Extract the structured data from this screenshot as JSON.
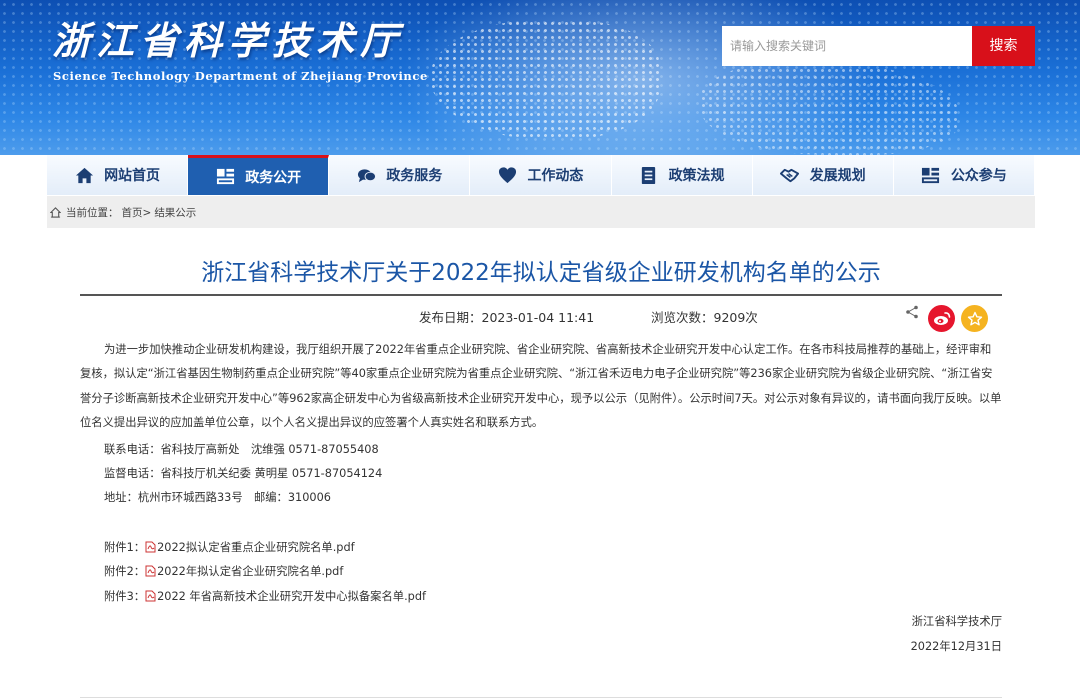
{
  "header": {
    "site_title": "浙江省科学技术厅",
    "site_subtitle": "Science Technology Department of Zhejiang Province",
    "search_placeholder": "请输入搜索关键词",
    "search_button": "搜索",
    "banner_colors": {
      "top": "#0d4fb3",
      "bottom": "#4d9cec"
    }
  },
  "nav": {
    "items": [
      {
        "label": "网站首页",
        "icon": "home-icon"
      },
      {
        "label": "政务公开",
        "icon": "gov-info-icon",
        "active": true
      },
      {
        "label": "政务服务",
        "icon": "chat-service-icon"
      },
      {
        "label": "工作动态",
        "icon": "heart-icon"
      },
      {
        "label": "政策法规",
        "icon": "document-list-icon"
      },
      {
        "label": "发展规划",
        "icon": "handshake-icon"
      },
      {
        "label": "公众参与",
        "icon": "participation-icon"
      }
    ],
    "active_color": "#1f5fb0",
    "accent_color": "#d8101a"
  },
  "breadcrumb": {
    "prefix": "当前位置：",
    "home": "首页>",
    "current": "结果公示"
  },
  "article": {
    "title": "浙江省科学技术厅关于2022年拟认定省级企业研发机构名单的公示",
    "publish_date": "发布日期：2023-01-04 11:41",
    "views": "浏览次数：9209次",
    "paragraph": "为进一步加快推动企业研发机构建设，我厅组织开展了2022年省重点企业研究院、省企业研究院、省高新技术企业研究开发中心认定工作。在各市科技局推荐的基础上，经评审和复核，拟认定“浙江省基因生物制药重点企业研究院”等40家重点企业研究院为省重点企业研究院、“浙江省禾迈电力电子企业研究院”等236家企业研究院为省级企业研究院、“浙江省安誉分子诊断高新技术企业研究开发中心”等962家高企研发中心为省级高新技术企业研究开发中心，现予以公示（见附件）。公示时间7天。对公示对象有异议的，请书面向我厅反映。以单位名义提出异议的应加盖单位公章，以个人名义提出异议的应签署个人真实姓名和联系方式。",
    "contact_phone": "联系电话：省科技厅高新处　沈维强 0571-87055408",
    "supervise_phone": "监督电话：省科技厅机关纪委  黄明星 0571-87054124",
    "address": "地址：杭州市环城西路33号　邮编：310006",
    "attachments": [
      {
        "prefix": "附件1：",
        "file": "2022拟认定省重点企业研究院名单.pdf"
      },
      {
        "prefix": "附件2：",
        "file": "2022年拟认定省企业研究院名单.pdf"
      },
      {
        "prefix": "附件3：",
        "file": "2022 年省高新技术企业研究开发中心拟备案名单.pdf"
      }
    ],
    "signature": "浙江省科学技术厅",
    "sign_date": "2022年12月31日"
  }
}
